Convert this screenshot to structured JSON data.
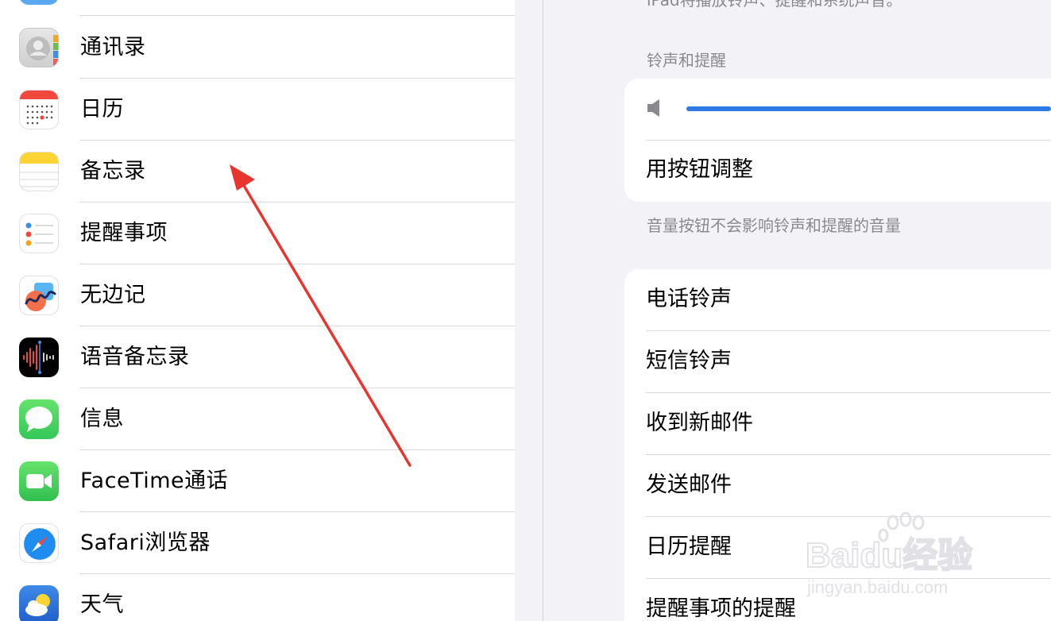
{
  "sidebar": {
    "items": [
      {
        "label": "通讯录",
        "icon": "contacts-icon"
      },
      {
        "label": "日历",
        "icon": "calendar-icon"
      },
      {
        "label": "备忘录",
        "icon": "notes-icon"
      },
      {
        "label": "提醒事项",
        "icon": "reminders-icon"
      },
      {
        "label": "无边记",
        "icon": "freeform-icon"
      },
      {
        "label": "语音备忘录",
        "icon": "voice-memos-icon"
      },
      {
        "label": "信息",
        "icon": "messages-icon"
      },
      {
        "label": "FaceTime通话",
        "icon": "facetime-icon"
      },
      {
        "label": "Safari浏览器",
        "icon": "safari-icon"
      },
      {
        "label": "天气",
        "icon": "weather-icon"
      }
    ]
  },
  "detail": {
    "top_footnote": "iPad将播放铃声、提醒和系统声音。",
    "ringer_section": {
      "header": "铃声和提醒",
      "volume_fraction": 1.0,
      "change_with_buttons_label": "用按钮调整",
      "footer": "音量按钮不会影响铃声和提醒的音量"
    },
    "sounds": [
      "电话铃声",
      "短信铃声",
      "收到新邮件",
      "发送邮件",
      "日历提醒",
      "提醒事项的提醒"
    ]
  },
  "watermark": {
    "brand": "Baidu经验",
    "url": "jingyan.baidu.com"
  },
  "colors": {
    "accent": "#2f7ae5",
    "annotation_arrow": "#e8352e"
  }
}
